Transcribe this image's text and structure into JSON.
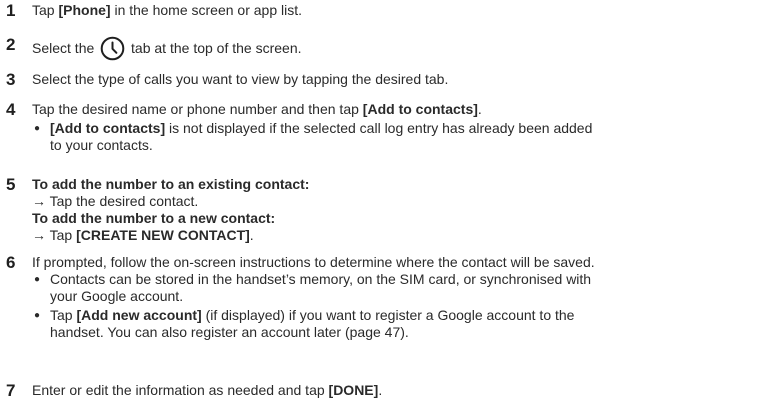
{
  "steps": [
    {
      "number": "1",
      "pre": "Tap ",
      "bold": "[Phone]",
      "post": " in the home screen or app list."
    },
    {
      "number": "2",
      "pre": "Select the ",
      "icon": "clock-icon",
      "post": " tab at the top of the screen."
    },
    {
      "number": "3",
      "text": "Select the type of calls you want to view by tapping the desired tab."
    },
    {
      "number": "4",
      "pre": "Tap the desired name or phone number and then tap ",
      "bold": "[Add to contacts]",
      "post": ".",
      "bullet_bold": "[Add to contacts]",
      "bullet_line1": " is not displayed if the selected call log entry has already been added",
      "bullet_line2": "to your contacts."
    },
    {
      "number": "5",
      "heading1": "To add the number to an existing contact:",
      "line1": "→ Tap the desired contact.",
      "heading2": "To add the number to a new contact:",
      "line2_pre": "→ Tap ",
      "line2_bold": "[CREATE NEW CONTACT]",
      "line2_post": "."
    },
    {
      "number": "6",
      "text": "If prompted, follow the on-screen instructions to determine where the contact will be saved.",
      "bullet1_line1": "Contacts can be stored in the handset’s memory, on the SIM card, or synchronised with",
      "bullet1_line2": "your Google account.",
      "bullet2_pre": "Tap ",
      "bullet2_bold": "[Add new account]",
      "bullet2_line1": " (if displayed) if you want to register a Google account to the",
      "bullet2_line2": "handset. You can also register an account later (page 47)."
    },
    {
      "number": "7",
      "pre": "Enter or edit the information as needed and tap ",
      "bold": "[DONE]",
      "post": "."
    }
  ]
}
